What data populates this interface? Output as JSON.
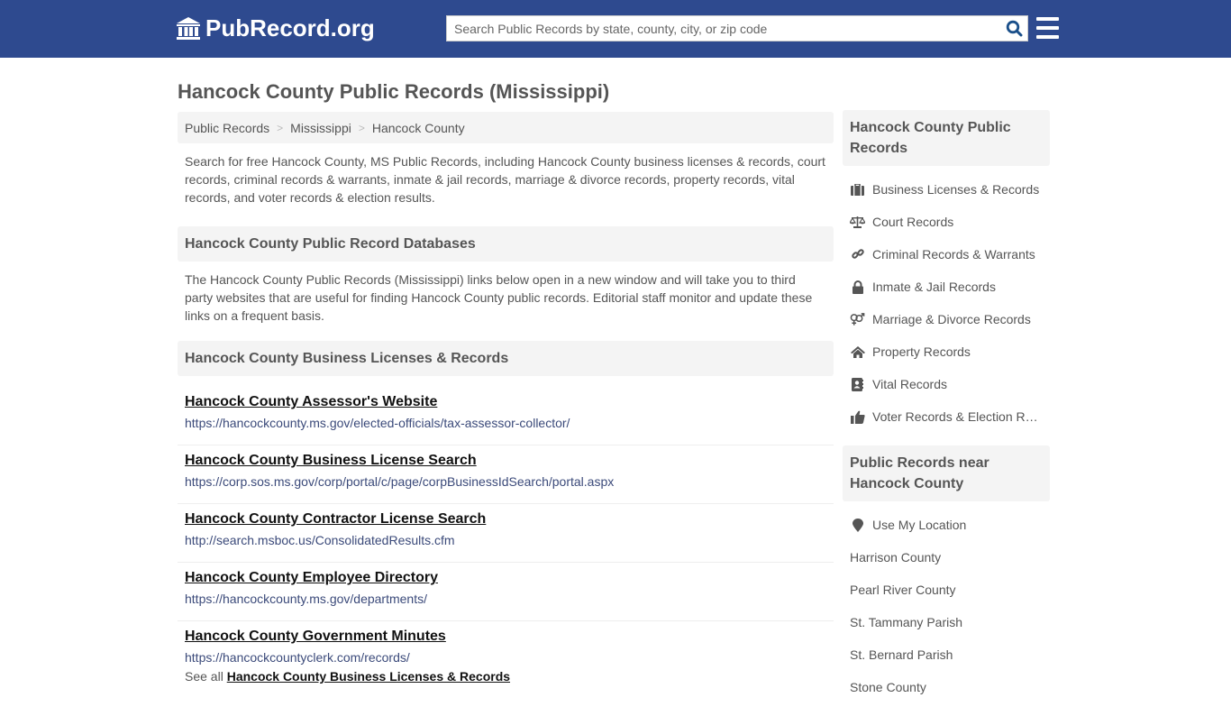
{
  "header": {
    "logo_text": "PubRecord.org",
    "search_placeholder": "Search Public Records by state, county, city, or zip code",
    "search_value": ""
  },
  "colors": {
    "header_bg": "#2e4a8f",
    "panel_bg": "#f4f4f4",
    "url_color": "#3b4a7a",
    "search_icon": "#1a4f8a"
  },
  "page": {
    "title": "Hancock County Public Records (Mississippi)",
    "breadcrumb": [
      "Public Records",
      "Mississippi",
      "Hancock County"
    ],
    "intro": "Search for free Hancock County, MS Public Records, including Hancock County business licenses & records, court records, criminal records & warrants, inmate & jail records, marriage & divorce records, property records, vital records, and voter records & election results.",
    "databases_heading": "Hancock County Public Record Databases",
    "databases_desc": "The Hancock County Public Records (Mississippi) links below open in a new window and will take you to third party websites that are useful for finding Hancock County public records. Editorial staff monitor and update these links on a frequent basis.",
    "business_heading": "Hancock County Business Licenses & Records",
    "links": [
      {
        "title": "Hancock County Assessor's Website",
        "url": "https://hancockcounty.ms.gov/elected-officials/tax-assessor-collector/"
      },
      {
        "title": "Hancock County Business License Search",
        "url": "https://corp.sos.ms.gov/corp/portal/c/page/corpBusinessIdSearch/portal.aspx"
      },
      {
        "title": "Hancock County Contractor License Search",
        "url": "http://search.msboc.us/ConsolidatedResults.cfm"
      },
      {
        "title": "Hancock County Employee Directory",
        "url": "https://hancockcounty.ms.gov/departments/"
      },
      {
        "title": "Hancock County Government Minutes",
        "url": "https://hancockcountyclerk.com/records/"
      }
    ],
    "see_all_prefix": "See all",
    "see_all_link": "Hancock County Business Licenses & Records"
  },
  "sidebar": {
    "records_heading": "Hancock County Public Records",
    "records": [
      {
        "icon": "briefcase-icon",
        "label": "Business Licenses & Records"
      },
      {
        "icon": "scale-icon",
        "label": "Court Records"
      },
      {
        "icon": "link-icon",
        "label": "Criminal Records & Warrants"
      },
      {
        "icon": "lock-icon",
        "label": "Inmate & Jail Records"
      },
      {
        "icon": "gender-icon",
        "label": "Marriage & Divorce Records"
      },
      {
        "icon": "home-icon",
        "label": "Property Records"
      },
      {
        "icon": "address-book-icon",
        "label": "Vital Records"
      },
      {
        "icon": "thumbs-up-icon",
        "label": "Voter Records & Election Results"
      }
    ],
    "nearby_heading": "Public Records near Hancock County",
    "use_location": "Use My Location",
    "nearby": [
      "Harrison County",
      "Pearl River County",
      "St. Tammany Parish",
      "St. Bernard Parish",
      "Stone County"
    ]
  }
}
